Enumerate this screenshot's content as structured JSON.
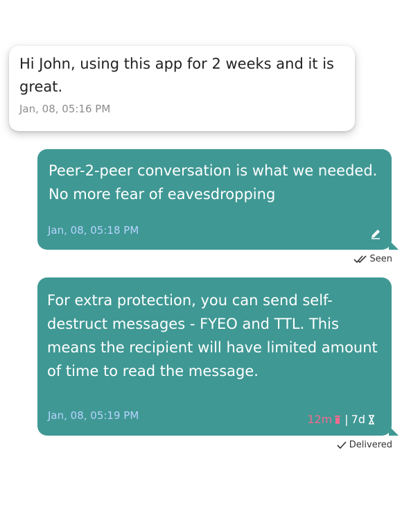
{
  "messages": [
    {
      "direction": "incoming",
      "text": "Hi John, using this app for 2 weeks and it is great.",
      "time": "Jan, 08, 05:16 PM"
    },
    {
      "direction": "outgoing",
      "text": "Peer-2-peer conversation is what we needed. No more fear of eavesdropping",
      "time": "Jan, 08, 05:18 PM",
      "icon": "pencil-icon",
      "status": "Seen",
      "status_icon": "double-check-icon"
    },
    {
      "direction": "outgoing",
      "text": "For extra protection, you can send self-destruct messages - FYEO and TTL. This means the recipient will have limited amount of time to read the message.",
      "time": "Jan, 08, 05:19 PM",
      "fyeo": "12m",
      "fyeo_icon": "trash-icon",
      "separator": "|",
      "ttl": "7d",
      "ttl_icon": "hourglass-icon",
      "status": "Delivered",
      "status_icon": "check-icon"
    }
  ],
  "colors": {
    "outgoing_bubble": "#3f9894",
    "incoming_bubble": "#ffffff",
    "timestamp_outgoing": "#b8d4ff",
    "fyeo_accent": "#f06b8f"
  }
}
